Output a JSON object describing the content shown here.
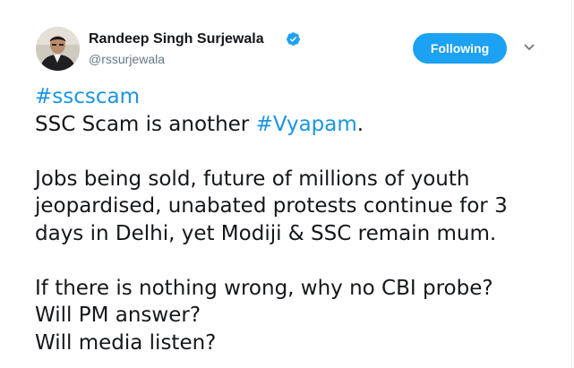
{
  "tweet": {
    "author": {
      "display_name": "Randeep Singh Surjewala",
      "screen_name": "@rssurjewala",
      "verified": true
    },
    "follow_button": {
      "label": "Following"
    },
    "menu_icon": "chevron-down-icon",
    "text": {
      "hashtag_top": "#sscscam",
      "line2_prefix": "SSC Scam is another ",
      "line2_hashtag": "#Vyapam",
      "line2_suffix": ".",
      "para2_line1": "Jobs being sold, future of millions of youth",
      "para2_line2": "jeopardised, unabated protests continue for 3",
      "para2_line3": "days in Delhi, yet Modiji & SSC remain mum.",
      "para3_line1": "If there is nothing wrong, why no CBI probe?",
      "para3_line2": "Will PM answer?",
      "para3_line3": "Will media listen?"
    }
  },
  "colors": {
    "accent": "#1da1f2",
    "hashtag": "#1b95e0",
    "text_primary": "#14171a",
    "text_secondary": "#657786"
  }
}
